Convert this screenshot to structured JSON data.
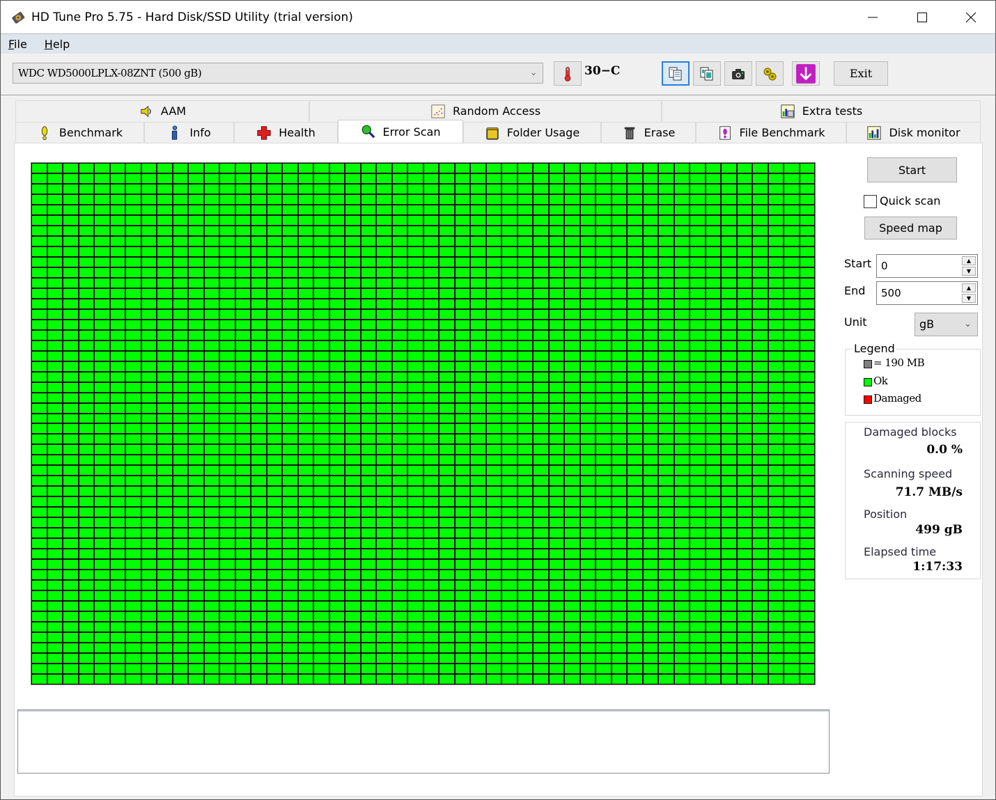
{
  "window": {
    "title": "HD Tune Pro 5.75 - Hard Disk/SSD Utility (trial version)",
    "controls": [
      "minimize",
      "maximize",
      "close"
    ]
  },
  "menu": [
    {
      "label": "File",
      "accel": "F",
      "rest": "ile"
    },
    {
      "label": "Help",
      "accel": "H",
      "rest": "elp"
    }
  ],
  "toolbar": {
    "drive": "WDC WD5000LPLX-08ZNT (500 gB)",
    "temperature": "30−C",
    "icons": [
      "copy-text-icon",
      "copy-image-icon",
      "screenshot-camera-icon",
      "options-gears-icon",
      "save-download-icon"
    ],
    "exit_label": "Exit"
  },
  "tabs": {
    "top": [
      {
        "label": "AAM",
        "icon": "speaker-icon"
      },
      {
        "label": "Random Access",
        "icon": "random-access-icon"
      },
      {
        "label": "Extra tests",
        "icon": "extra-tests-icon"
      }
    ],
    "bottom": [
      {
        "label": "Benchmark",
        "icon": "exclamation-icon"
      },
      {
        "label": "Info",
        "icon": "info-icon"
      },
      {
        "label": "Health",
        "icon": "health-cross-icon"
      },
      {
        "label": "Error Scan",
        "icon": "magnifier-icon",
        "active": true
      },
      {
        "label": "Folder Usage",
        "icon": "folder-icon"
      },
      {
        "label": "Erase",
        "icon": "trash-icon"
      },
      {
        "label": "File Benchmark",
        "icon": "file-benchmark-icon"
      },
      {
        "label": "Disk monitor",
        "icon": "disk-monitor-icon"
      }
    ]
  },
  "scan": {
    "start_label": "Start",
    "quick_scan_label": "Quick scan",
    "quick_scan_checked": false,
    "speed_map_label": "Speed map",
    "start_field_label": "Start",
    "start_value": "0",
    "end_field_label": "End",
    "end_value": "500",
    "unit_label": "Unit",
    "unit_value": "gB",
    "grid": {
      "columns": 50,
      "rows": 50,
      "status": "ok",
      "ok_color": "#00ff00",
      "damaged_color": "#ff0000"
    }
  },
  "legend": {
    "title": "Legend",
    "items": [
      {
        "label": "= 190 MB",
        "color": "#808080"
      },
      {
        "label": "Ok",
        "color": "#00ff00"
      },
      {
        "label": "Damaged",
        "color": "#ff0000"
      }
    ]
  },
  "stats": {
    "damaged_blocks_label": "Damaged blocks",
    "damaged_blocks_value": "0.0 %",
    "scanning_speed_label": "Scanning speed",
    "scanning_speed_value": "71.7 MB/s",
    "position_label": "Position",
    "position_value": "499 gB",
    "elapsed_label": "Elapsed time",
    "elapsed_value": "1:17:33"
  },
  "log_text": ""
}
